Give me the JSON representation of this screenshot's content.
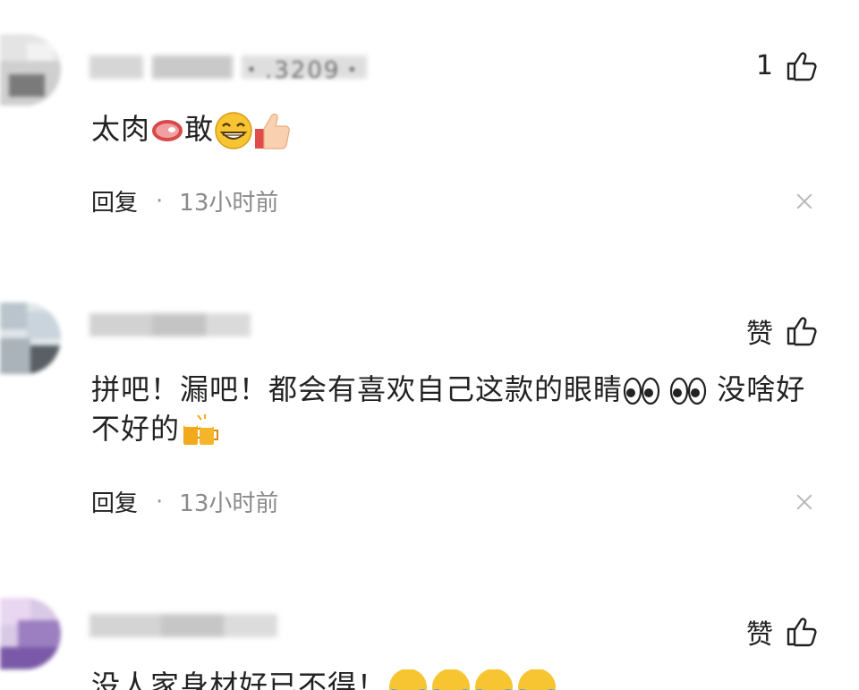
{
  "comments": [
    {
      "like_count": "1",
      "text_before": "太肉",
      "text_mid": "敢",
      "reply_label": "回复",
      "separator": "·",
      "time": "13小时前",
      "username_fragment": "・.3209・"
    },
    {
      "like_label": "赞",
      "line1": "拼吧！漏吧！都会有喜欢自己这款的眼睛",
      "line1_tail": "没啥好",
      "line2": "不好的",
      "reply_label": "回复",
      "separator": "·",
      "time": "13小时前"
    },
    {
      "like_label": "赞",
      "text_partial": "没人家身材好已不得！"
    }
  ],
  "icons": {
    "like": "thumbs-up-icon",
    "close": "close-icon"
  },
  "colors": {
    "text": "#222222",
    "muted": "#8a8a8a",
    "close": "#b8b8b8"
  }
}
